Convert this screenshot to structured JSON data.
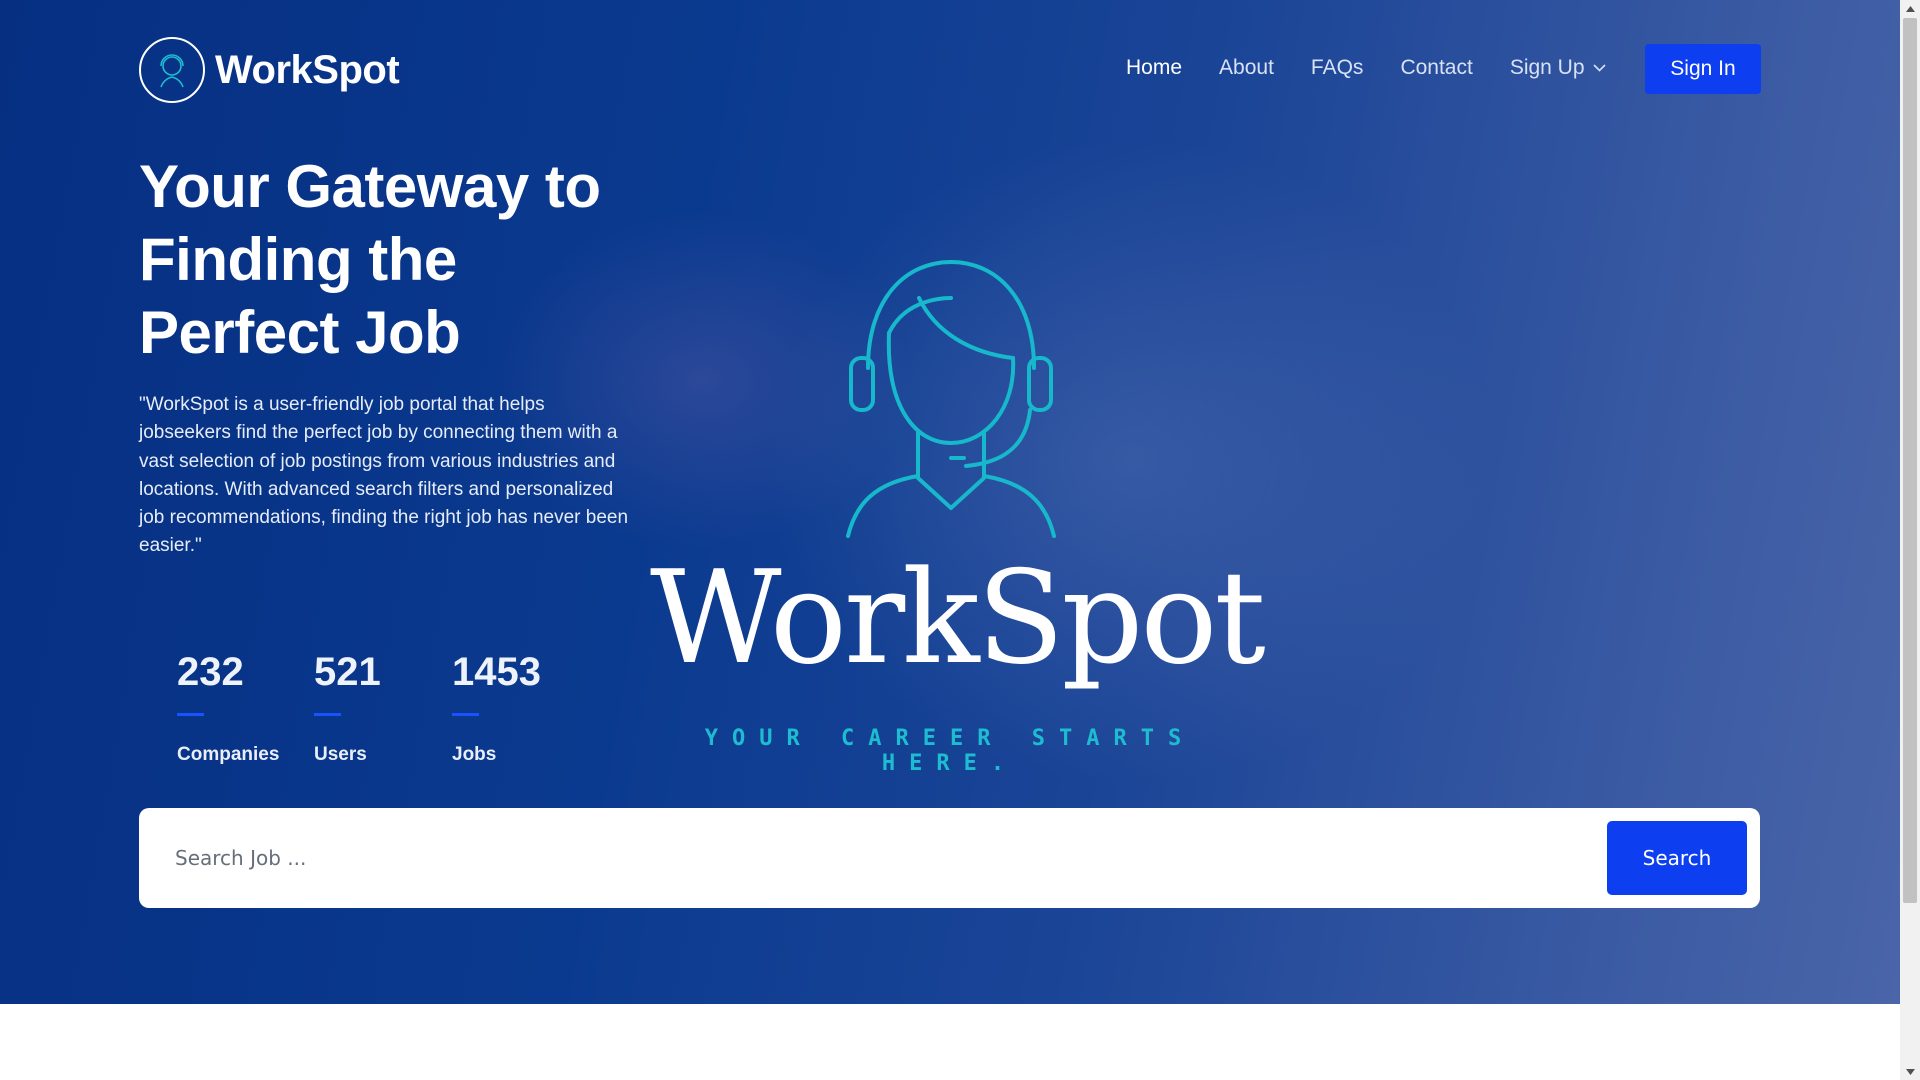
{
  "brand": {
    "name": "WorkSpot",
    "tagline": "YOUR CAREER STARTS HERE."
  },
  "nav": {
    "items": [
      {
        "label": "Home",
        "active": true
      },
      {
        "label": "About"
      },
      {
        "label": "FAQs"
      },
      {
        "label": "Contact"
      },
      {
        "label": "Sign Up",
        "has_dropdown": true
      }
    ],
    "signin_label": "Sign In"
  },
  "hero": {
    "headline_lines": [
      "Your Gateway to",
      "Finding the",
      "Perfect Job"
    ],
    "description": "\"WorkSpot is a user-friendly job portal that helps jobseekers find the perfect job by connecting them with a vast selection of job postings from various industries and locations. With advanced search filters and personalized job recommendations, finding the right job has never been easier.\""
  },
  "stats": [
    {
      "value": "232",
      "label": "Companies"
    },
    {
      "value": "521",
      "label": "Users"
    },
    {
      "value": "1453",
      "label": "Jobs"
    }
  ],
  "search": {
    "placeholder": "Search Job ...",
    "button_label": "Search"
  },
  "colors": {
    "accent": "#0d3ef0",
    "hero_dark": "#062f82",
    "teal": "#1ebcd0"
  },
  "icons": {
    "logo": "headset-person-icon",
    "dropdown": "chevron-down-icon"
  }
}
